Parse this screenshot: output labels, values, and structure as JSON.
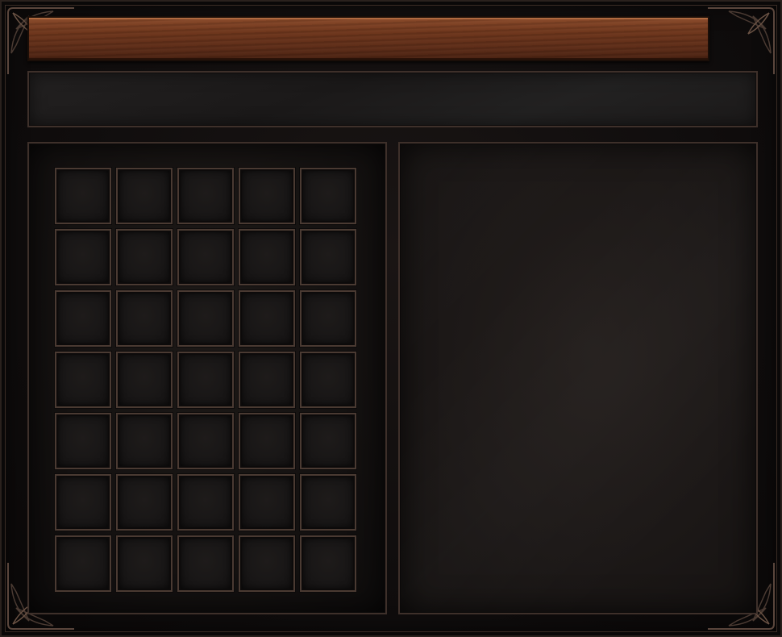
{
  "title_bar": {
    "title": ""
  },
  "subheader": {
    "text": ""
  },
  "inventory": {
    "columns": 5,
    "rows": 7,
    "slots": [
      {
        "item": ""
      },
      {
        "item": ""
      },
      {
        "item": ""
      },
      {
        "item": ""
      },
      {
        "item": ""
      },
      {
        "item": ""
      },
      {
        "item": ""
      },
      {
        "item": ""
      },
      {
        "item": ""
      },
      {
        "item": ""
      },
      {
        "item": ""
      },
      {
        "item": ""
      },
      {
        "item": ""
      },
      {
        "item": ""
      },
      {
        "item": ""
      },
      {
        "item": ""
      },
      {
        "item": ""
      },
      {
        "item": ""
      },
      {
        "item": ""
      },
      {
        "item": ""
      },
      {
        "item": ""
      },
      {
        "item": ""
      },
      {
        "item": ""
      },
      {
        "item": ""
      },
      {
        "item": ""
      },
      {
        "item": ""
      },
      {
        "item": ""
      },
      {
        "item": ""
      },
      {
        "item": ""
      },
      {
        "item": ""
      },
      {
        "item": ""
      },
      {
        "item": ""
      },
      {
        "item": ""
      },
      {
        "item": ""
      },
      {
        "item": ""
      }
    ]
  },
  "details": {
    "text": ""
  },
  "colors": {
    "title_wood": "#6e361c",
    "frame_border": "#3e302a",
    "slot_border": "#4a3a32",
    "background": "#0c0a0a"
  },
  "icons": [
    "corner-ornament-icon"
  ]
}
